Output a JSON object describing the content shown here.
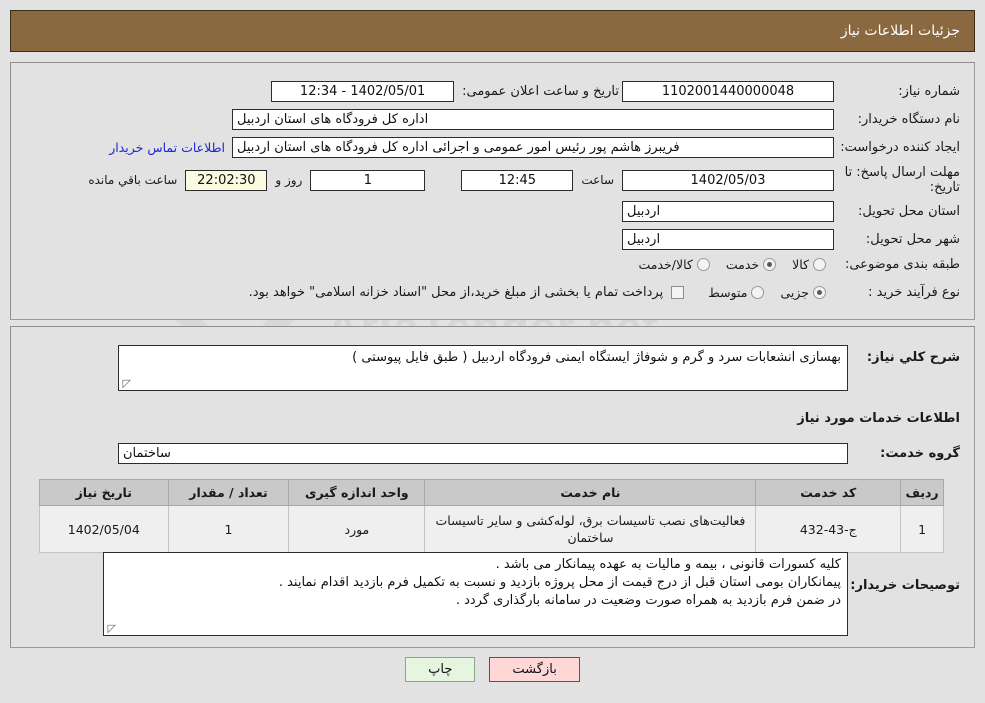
{
  "header": {
    "title": "جزئیات اطلاعات نیاز"
  },
  "fields": {
    "need_number_label": "شماره نیاز:",
    "need_number_value": "1102001440000048",
    "announce_label": "تاریخ و ساعت اعلان عمومی:",
    "announce_value": "1402/05/01 - 12:34",
    "buyer_org_label": "نام دستگاه خریدار:",
    "buyer_org_value": "اداره کل فرودگاه های استان اردبیل",
    "requester_label": "ایجاد کننده درخواست:",
    "requester_value": "فریبرز هاشم پور رئیس امور عمومی و اجرائی اداره کل فرودگاه های استان اردبیل",
    "contact_link": "اطلاعات تماس خریدار",
    "deadline_label": "مهلت ارسال پاسخ: تا تاریخ:",
    "deadline_date": "1402/05/03",
    "time_label": "ساعت",
    "deadline_time": "12:45",
    "days_value": "1",
    "days_label": "روز و",
    "countdown_value": "22:02:30",
    "countdown_label": "ساعت باقي مانده",
    "province_label": "استان محل تحویل:",
    "province_value": "اردبیل",
    "city_label": "شهر محل تحویل:",
    "city_value": "اردبیل",
    "category_label": "طبقه بندی موضوعی:",
    "purchase_type_label": "نوع فرآیند خرید :",
    "treasury_note": "پرداخت تمام یا بخشی از مبلغ خرید،از محل \"اسناد خزانه اسلامی\" خواهد بود."
  },
  "category_options": [
    {
      "label": "کالا",
      "selected": false
    },
    {
      "label": "خدمت",
      "selected": true
    },
    {
      "label": "کالا/خدمت",
      "selected": false
    }
  ],
  "purchase_options": [
    {
      "label": "جزیی",
      "selected": true
    },
    {
      "label": "متوسط",
      "selected": false
    }
  ],
  "description": {
    "label": "شرح کلي نياز:",
    "value": "بهسازی انشعابات سرد و گرم و شوفاژ ایستگاه ایمنی فرودگاه اردبیل ( طبق فایل پیوستی )",
    "services_heading": "اطلاعات خدمات مورد نیاز",
    "group_label": "گروه خدمت:",
    "group_value": "ساختمان"
  },
  "table": {
    "headers": [
      "ردیف",
      "کد خدمت",
      "نام خدمت",
      "واحد اندازه گیری",
      "تعداد / مقدار",
      "تاریخ نیاز"
    ],
    "rows": [
      {
        "row": "1",
        "code": "ج-43-432",
        "name": "فعالیت‌های نصب تاسیسات برق، لوله‌کشی و سایر تاسیسات ساختمان",
        "unit": "مورد",
        "qty": "1",
        "date": "1402/05/04"
      }
    ]
  },
  "notes": {
    "label": "توصیحات خریدار:",
    "lines": [
      "کلیه کسورات قانونی ، بیمه و مالیات به عهده پیمانکار می باشد .",
      "پیمانکاران بومی استان قبل از درج قیمت از محل پروژه بازدید و نسبت به تکمیل فرم بازدید اقدام نمایند .",
      "در ضمن فرم بازدید به همراه صورت وضعیت در سامانه بارگذاری گردد ."
    ]
  },
  "buttons": {
    "back": "بازگشت",
    "print": "چاپ"
  },
  "watermark": {
    "text": "AriaTender.net"
  },
  "colors": {
    "header_bg": "#8b6940",
    "page_bg": "#e2e2e2",
    "link": "#1a24d8",
    "countdown_bg": "#fbfbe2",
    "back_btn": "#ffd7d7",
    "print_btn": "#e6f5e0"
  }
}
